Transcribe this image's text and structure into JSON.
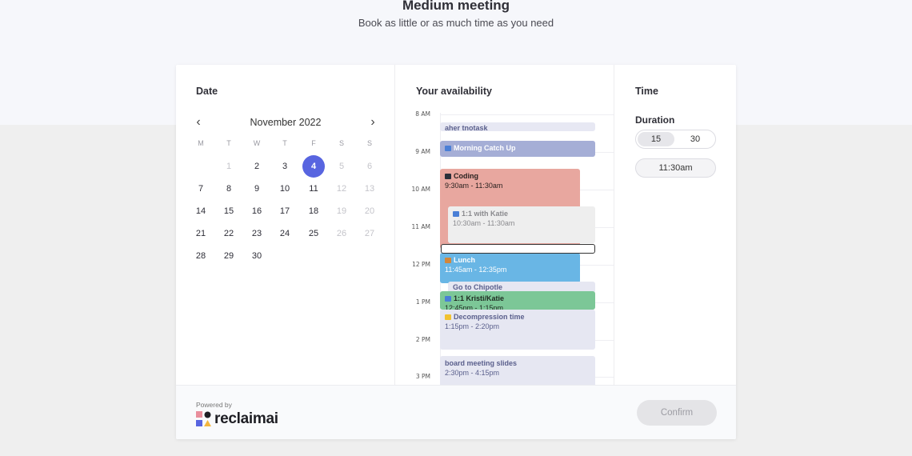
{
  "header": {
    "title": "Medium meeting",
    "subtitle": "Book as little or as much time as you need"
  },
  "date": {
    "title": "Date",
    "month_label": "November 2022",
    "prev_icon": "chevron-left-icon",
    "next_icon": "chevron-right-icon",
    "weekdays": [
      "M",
      "T",
      "W",
      "T",
      "F",
      "S",
      "S"
    ],
    "first_weekday_index": 1,
    "days": [
      {
        "n": "1",
        "state": "muted"
      },
      {
        "n": "2",
        "state": "normal"
      },
      {
        "n": "3",
        "state": "normal"
      },
      {
        "n": "4",
        "state": "selected"
      },
      {
        "n": "5",
        "state": "muted"
      },
      {
        "n": "6",
        "state": "muted"
      },
      {
        "n": "7",
        "state": "normal"
      },
      {
        "n": "8",
        "state": "normal"
      },
      {
        "n": "9",
        "state": "normal"
      },
      {
        "n": "10",
        "state": "normal"
      },
      {
        "n": "11",
        "state": "normal"
      },
      {
        "n": "12",
        "state": "muted"
      },
      {
        "n": "13",
        "state": "muted"
      },
      {
        "n": "14",
        "state": "normal"
      },
      {
        "n": "15",
        "state": "normal"
      },
      {
        "n": "16",
        "state": "normal"
      },
      {
        "n": "17",
        "state": "normal"
      },
      {
        "n": "18",
        "state": "normal"
      },
      {
        "n": "19",
        "state": "muted"
      },
      {
        "n": "20",
        "state": "muted"
      },
      {
        "n": "21",
        "state": "normal"
      },
      {
        "n": "22",
        "state": "normal"
      },
      {
        "n": "23",
        "state": "normal"
      },
      {
        "n": "24",
        "state": "normal"
      },
      {
        "n": "25",
        "state": "normal"
      },
      {
        "n": "26",
        "state": "muted"
      },
      {
        "n": "27",
        "state": "muted"
      },
      {
        "n": "28",
        "state": "normal"
      },
      {
        "n": "29",
        "state": "normal"
      },
      {
        "n": "30",
        "state": "normal"
      }
    ]
  },
  "availability": {
    "title": "Your availability",
    "hour_labels": [
      "8 AM",
      "9 AM",
      "10 AM",
      "11 AM",
      "12 PM",
      "1 PM",
      "2 PM",
      "3 PM"
    ],
    "events": [
      {
        "key": "aher",
        "title": "aher tnotask",
        "time": "",
        "icon": "",
        "bg": "#e7e8f3",
        "fg": "#5a5f8c"
      },
      {
        "key": "morning",
        "title": "Morning Catch Up",
        "time": "",
        "icon": "calendar-icon",
        "bg": "#a5aed6",
        "fg": "#ffffff"
      },
      {
        "key": "coding",
        "title": "Coding",
        "time": "9:30am - 11:30am",
        "icon": "computer-icon",
        "bg": "#e8a79f",
        "fg": "#2a2220"
      },
      {
        "key": "katie",
        "title": "1:1 with Katie",
        "time": "10:30am - 11:30am",
        "icon": "calendar-icon",
        "bg": "#eeeeee",
        "fg": "#8a8a8e"
      },
      {
        "key": "lunch",
        "title": "Lunch",
        "time": "11:45am - 12:35pm",
        "icon": "food-icon",
        "bg": "#69b6e5",
        "fg": "#ffffff"
      },
      {
        "key": "chipotle",
        "title": "Go to Chipotle",
        "time": "",
        "icon": "",
        "bg": "#e6e7f2",
        "fg": "#5a5f8c"
      },
      {
        "key": "kristi",
        "title": "1:1 Kristi/Katie",
        "time": "12:45pm - 1:15pm",
        "icon": "calendar-icon",
        "bg": "#7cc797",
        "fg": "#1f2a22"
      },
      {
        "key": "decompress",
        "title": "Decompression time",
        "time": "1:15pm - 2:20pm",
        "icon": "sunglasses-icon",
        "bg": "#e6e7f2",
        "fg": "#5a5f8c"
      },
      {
        "key": "board",
        "title": "board meeting slides",
        "time": "2:30pm - 4:15pm",
        "icon": "",
        "bg": "#e6e7f2",
        "fg": "#5a5f8c"
      }
    ]
  },
  "time": {
    "title": "Time",
    "duration_label": "Duration",
    "duration_options": [
      "15",
      "30"
    ],
    "duration_selected": "15",
    "slot": "11:30am"
  },
  "footer": {
    "powered_by": "Powered by",
    "brand": "reclaimai",
    "confirm_label": "Confirm"
  },
  "colors": {
    "accent": "#5865e0",
    "confirm_disabled_bg": "#e4e4e7"
  }
}
